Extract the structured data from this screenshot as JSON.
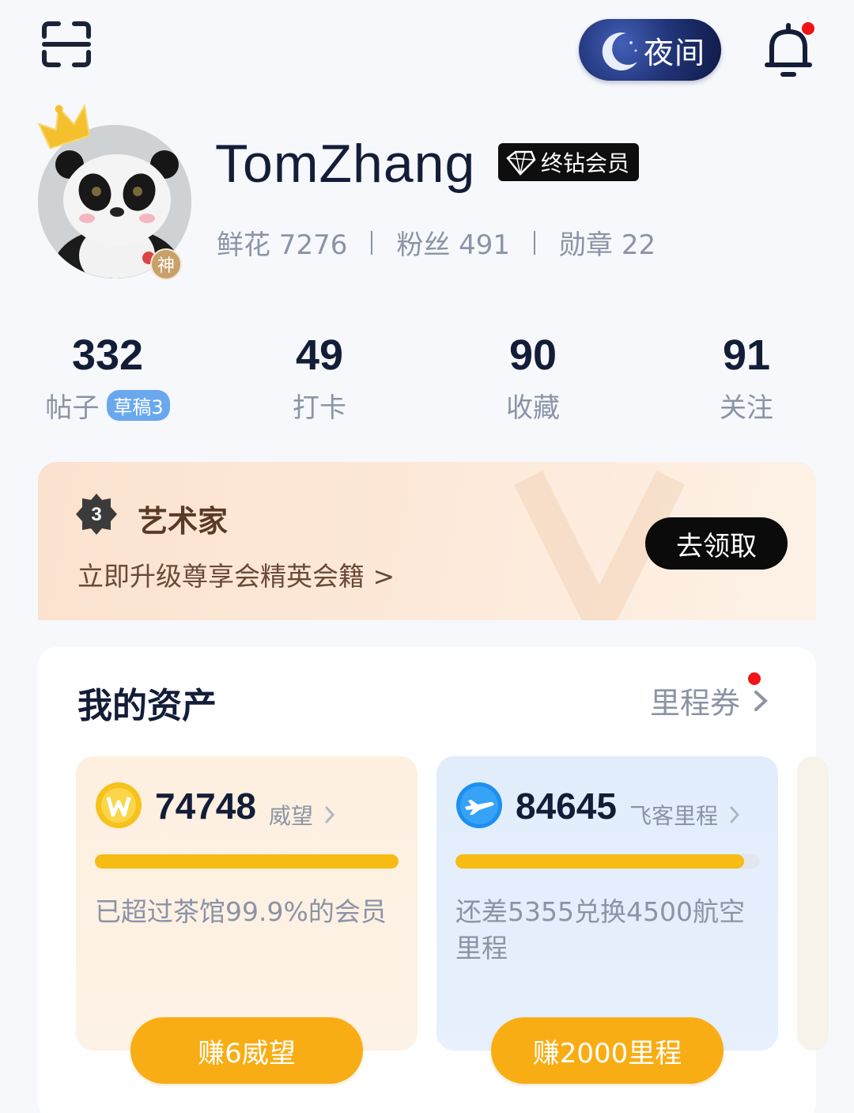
{
  "header": {
    "night_mode_label": "夜间"
  },
  "profile": {
    "username": "TomZhang",
    "vip_label": "终钻会员",
    "avatar_badge": "神",
    "flowers": "鲜花 7276",
    "fans": "粉丝 491",
    "medals": "勋章 22"
  },
  "counters": [
    {
      "value": "332",
      "label": "帖子",
      "pill": "草稿3"
    },
    {
      "value": "49",
      "label": "打卡"
    },
    {
      "value": "90",
      "label": "收藏"
    },
    {
      "value": "91",
      "label": "关注"
    }
  ],
  "artist": {
    "level": "3",
    "title": "艺术家",
    "subtitle": "立即升级尊享会精英会籍 >",
    "claim_label": "去领取"
  },
  "assets": {
    "title": "我的资产",
    "voucher_label": "里程券",
    "tiles": [
      {
        "amount": "74748",
        "unit": "威望",
        "progress": 1.0,
        "description": "已超过茶馆99.9%的会员",
        "button": "赚6威望"
      },
      {
        "amount": "84645",
        "unit": "飞客里程",
        "progress": 0.95,
        "description": "还差5355兑换4500航空里程",
        "button": "赚2000里程"
      }
    ]
  },
  "colors": {
    "accent_yellow": "#f6bc14",
    "button_orange": "#f9ad14",
    "notification_dot": "#f01414",
    "text_dark": "#141d38",
    "text_muted": "#8b93a5"
  }
}
